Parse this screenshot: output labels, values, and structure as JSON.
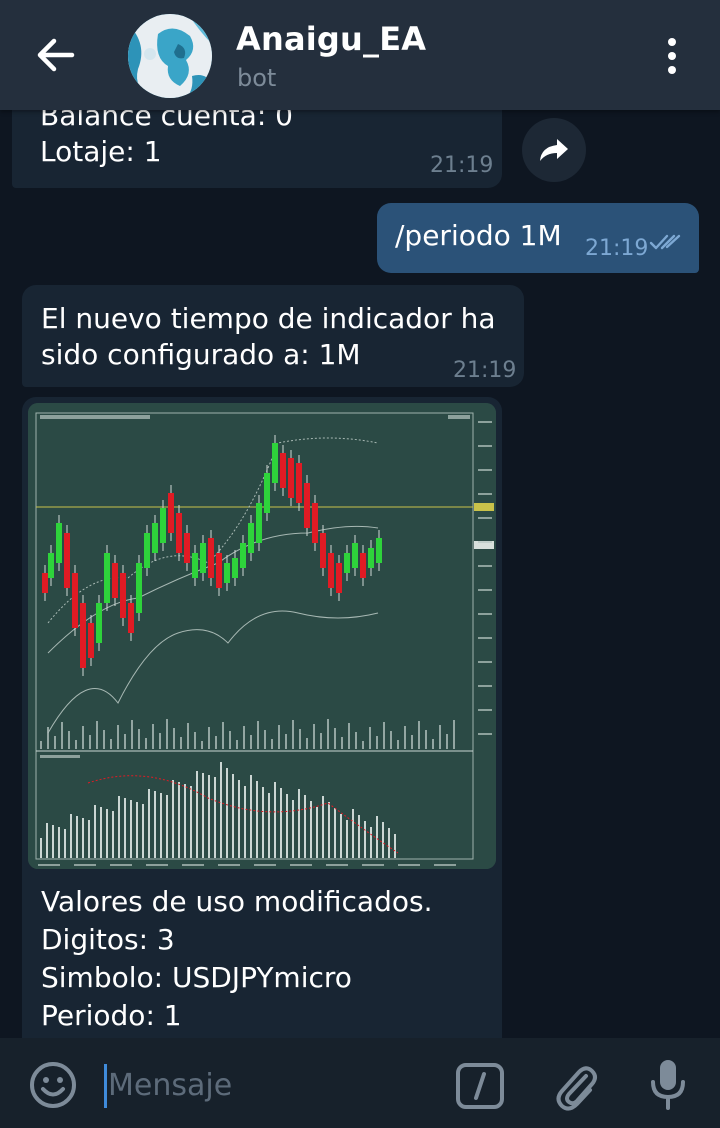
{
  "header": {
    "title": "Anaigu_EA",
    "subtitle": "bot"
  },
  "messages": [
    {
      "direction": "incoming",
      "lines": [
        "Balance cuenta: 0",
        "Lotaje: 1"
      ],
      "time": "21:19"
    },
    {
      "direction": "outgoing",
      "text": "/periodo 1M",
      "time": "21:19",
      "status": "read"
    },
    {
      "direction": "incoming",
      "lines": [
        "El nuevo tiempo de indicador ha",
        "sido configurado a: 1M"
      ],
      "time": "21:19"
    },
    {
      "direction": "incoming",
      "has_photo": true,
      "lines": [
        "Valores de uso modificados.",
        "Digitos: 3",
        "Simbolo: USDJPYmicro",
        "Periodo: 1"
      ]
    }
  ],
  "composer": {
    "placeholder": "Mensaje"
  },
  "colors": {
    "background": "#0e1621",
    "header": "#242f3d",
    "incoming_bubble": "#182533",
    "outgoing_bubble": "#2b5278",
    "chart_background": "#2b4a45",
    "candle_up": "#2ed33b",
    "candle_down": "#e01b24"
  },
  "icons": {
    "back": "arrow-left-icon",
    "menu": "more-vertical-icon",
    "forward": "share-arrow-icon",
    "read": "double-check-icon",
    "emoji": "smiley-icon",
    "command": "slash-command-icon",
    "attach": "paperclip-icon",
    "mic": "microphone-icon"
  }
}
